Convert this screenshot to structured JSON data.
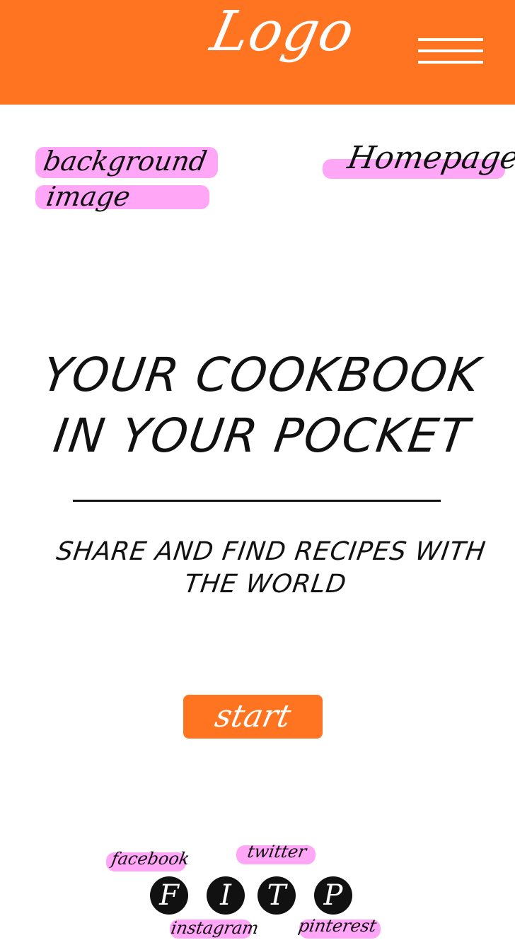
{
  "header": {
    "logo": "Logo",
    "menu_icon": "hamburger-menu-icon",
    "background_color": "#ff7420"
  },
  "annotations": {
    "background_image_line1": "background",
    "background_image_line2": "image",
    "page_name": "Homepage",
    "highlight_color": "#ffa6f7"
  },
  "hero": {
    "title_line1": "YOUR COOKBOOK",
    "title_line2": "IN YOUR POCKET",
    "subtitle_line1": "SHARE AND FIND RECIPES WITH",
    "subtitle_line2": "THE WORLD"
  },
  "cta": {
    "start_label": "start",
    "color": "#ff7420"
  },
  "social": {
    "labels": {
      "facebook": "facebook",
      "twitter": "twitter",
      "instagram": "instagram",
      "pinterest": "pinterest"
    },
    "buttons": [
      {
        "letter": "F",
        "icon": "facebook-icon"
      },
      {
        "letter": "I",
        "icon": "instagram-icon"
      },
      {
        "letter": "T",
        "icon": "twitter-icon"
      },
      {
        "letter": "P",
        "icon": "pinterest-icon"
      }
    ]
  }
}
